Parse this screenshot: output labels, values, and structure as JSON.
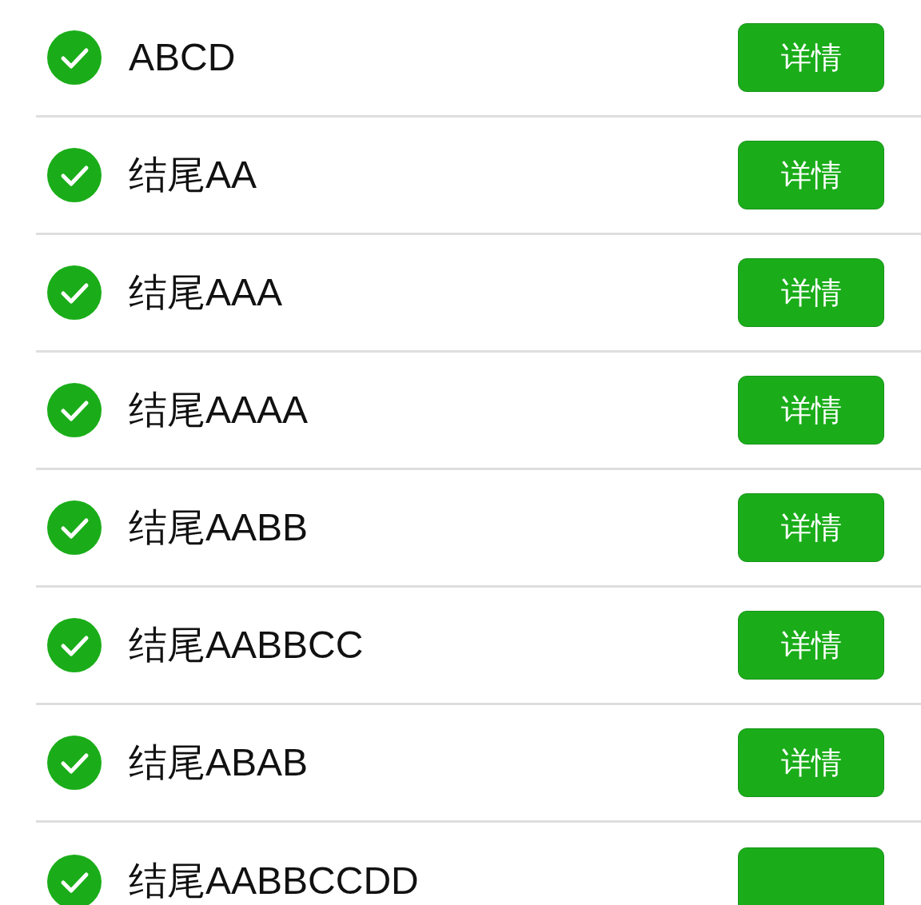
{
  "items": [
    {
      "label": "ABCD",
      "checked": true,
      "button": "详情"
    },
    {
      "label": "结尾AA",
      "checked": true,
      "button": "详情"
    },
    {
      "label": "结尾AAA",
      "checked": true,
      "button": "详情"
    },
    {
      "label": "结尾AAAA",
      "checked": true,
      "button": "详情"
    },
    {
      "label": "结尾AABB",
      "checked": true,
      "button": "详情"
    },
    {
      "label": "结尾AABBCC",
      "checked": true,
      "button": "详情"
    },
    {
      "label": "结尾ABAB",
      "checked": true,
      "button": "详情"
    },
    {
      "label": "结尾AABBCCDD",
      "checked": true,
      "button_obscured": true
    }
  ]
}
